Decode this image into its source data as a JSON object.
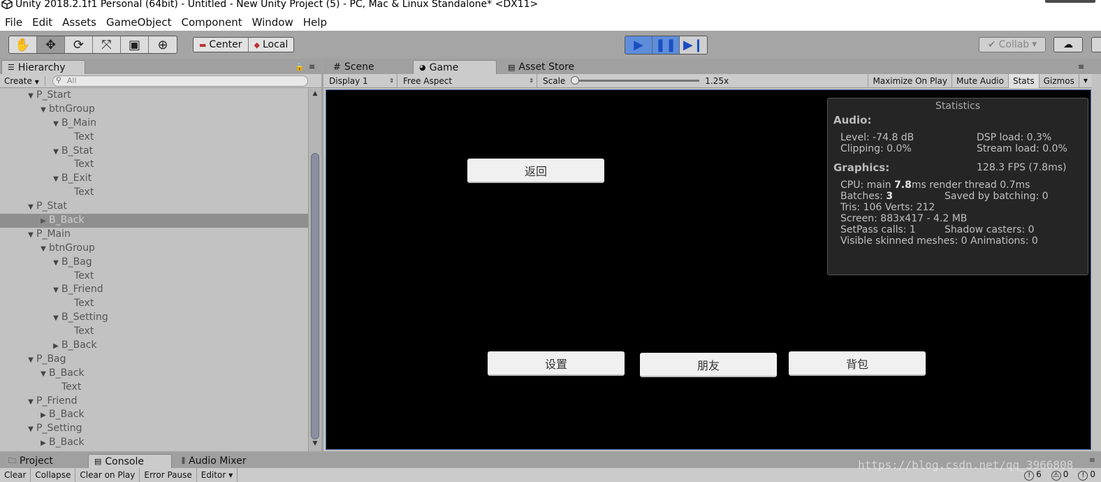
{
  "window": {
    "title": "Unity 2018.2.1f1 Personal (64bit) - Untitled - New Unity Project (5) - PC, Mac & Linux Standalone* <DX11>"
  },
  "menu": [
    "File",
    "Edit",
    "Assets",
    "GameObject",
    "Component",
    "Window",
    "Help"
  ],
  "toolbar": {
    "transform_tools": [
      "hand-icon",
      "move-icon",
      "rotate-icon",
      "scale-icon",
      "rect-icon",
      "transform-icon"
    ],
    "pivot_center": "Center",
    "pivot_local": "Local",
    "collab": "Collab",
    "play_controls": [
      "play-icon",
      "pause-icon",
      "step-icon"
    ]
  },
  "hierarchy": {
    "tab": "Hierarchy",
    "create": "Create",
    "search_placeholder": "All",
    "items": [
      {
        "label": "P_Start",
        "depth": 0,
        "arrow": "▼"
      },
      {
        "label": "btnGroup",
        "depth": 1,
        "arrow": "▼"
      },
      {
        "label": "B_Main",
        "depth": 2,
        "arrow": "▼"
      },
      {
        "label": "Text",
        "depth": 3,
        "arrow": ""
      },
      {
        "label": "B_Stat",
        "depth": 2,
        "arrow": "▼"
      },
      {
        "label": "Text",
        "depth": 3,
        "arrow": ""
      },
      {
        "label": "B_Exit",
        "depth": 2,
        "arrow": "▼"
      },
      {
        "label": "Text",
        "depth": 3,
        "arrow": ""
      },
      {
        "label": "P_Stat",
        "depth": 0,
        "arrow": "▼"
      },
      {
        "label": "B_Back",
        "depth": 1,
        "arrow": "▶",
        "selected": true
      },
      {
        "label": "P_Main",
        "depth": 0,
        "arrow": "▼"
      },
      {
        "label": "btnGroup",
        "depth": 1,
        "arrow": "▼"
      },
      {
        "label": "B_Bag",
        "depth": 2,
        "arrow": "▼"
      },
      {
        "label": "Text",
        "depth": 3,
        "arrow": ""
      },
      {
        "label": "B_Friend",
        "depth": 2,
        "arrow": "▼"
      },
      {
        "label": "Text",
        "depth": 3,
        "arrow": ""
      },
      {
        "label": "B_Setting",
        "depth": 2,
        "arrow": "▼"
      },
      {
        "label": "Text",
        "depth": 3,
        "arrow": ""
      },
      {
        "label": "B_Back",
        "depth": 2,
        "arrow": "▶"
      },
      {
        "label": "P_Bag",
        "depth": 0,
        "arrow": "▼"
      },
      {
        "label": "B_Back",
        "depth": 1,
        "arrow": "▼"
      },
      {
        "label": "Text",
        "depth": 2,
        "arrow": ""
      },
      {
        "label": "P_Friend",
        "depth": 0,
        "arrow": "▼"
      },
      {
        "label": "B_Back",
        "depth": 1,
        "arrow": "▶"
      },
      {
        "label": "P_Setting",
        "depth": 0,
        "arrow": "▼"
      },
      {
        "label": "B_Back",
        "depth": 1,
        "arrow": "▶"
      }
    ]
  },
  "center_tabs": {
    "scene": "Scene",
    "game": "Game",
    "asset_store": "Asset Store"
  },
  "game_toolbar": {
    "display": "Display 1",
    "aspect": "Free Aspect",
    "scale_label": "Scale",
    "scale_value": "1.25x",
    "scale_fraction": 0.0,
    "maximize": "Maximize On Play",
    "mute": "Mute Audio",
    "stats": "Stats",
    "gizmos": "Gizmos"
  },
  "game_view": {
    "back_button": "返回",
    "setting_button": "设置",
    "friend_button": "朋友",
    "bag_button": "背包"
  },
  "stats": {
    "header": "Statistics",
    "audio_title": "Audio:",
    "level": "Level: -74.8 dB",
    "dsp": "DSP load: 0.3%",
    "clipping": "Clipping: 0.0%",
    "stream": "Stream load: 0.0%",
    "graphics_title": "Graphics:",
    "fps": "128.3 FPS (7.8ms)",
    "cpu_prefix": "CPU: main ",
    "cpu_main": "7.8",
    "cpu_suffix": "ms  render thread 0.7ms",
    "batches_prefix": "Batches: ",
    "batches": "3",
    "saved_batching": "Saved by batching: 0",
    "tris": "Tris: 106  Verts: 212",
    "screen": "Screen: 883x417 - 4.2 MB",
    "setpass": "SetPass calls: 1",
    "shadow": "Shadow casters: 0",
    "skinned": "Visible skinned meshes: 0  Animations: 0"
  },
  "bottom": {
    "tabs": [
      "Project",
      "Console",
      "Audio Mixer"
    ],
    "console_tools": [
      "Clear",
      "Collapse",
      "Clear on Play",
      "Error Pause",
      "Editor"
    ],
    "log_count": "6",
    "warn_count": "0",
    "error_count": "0",
    "watermark": "https://blog.csdn.net/qq_3966808"
  }
}
